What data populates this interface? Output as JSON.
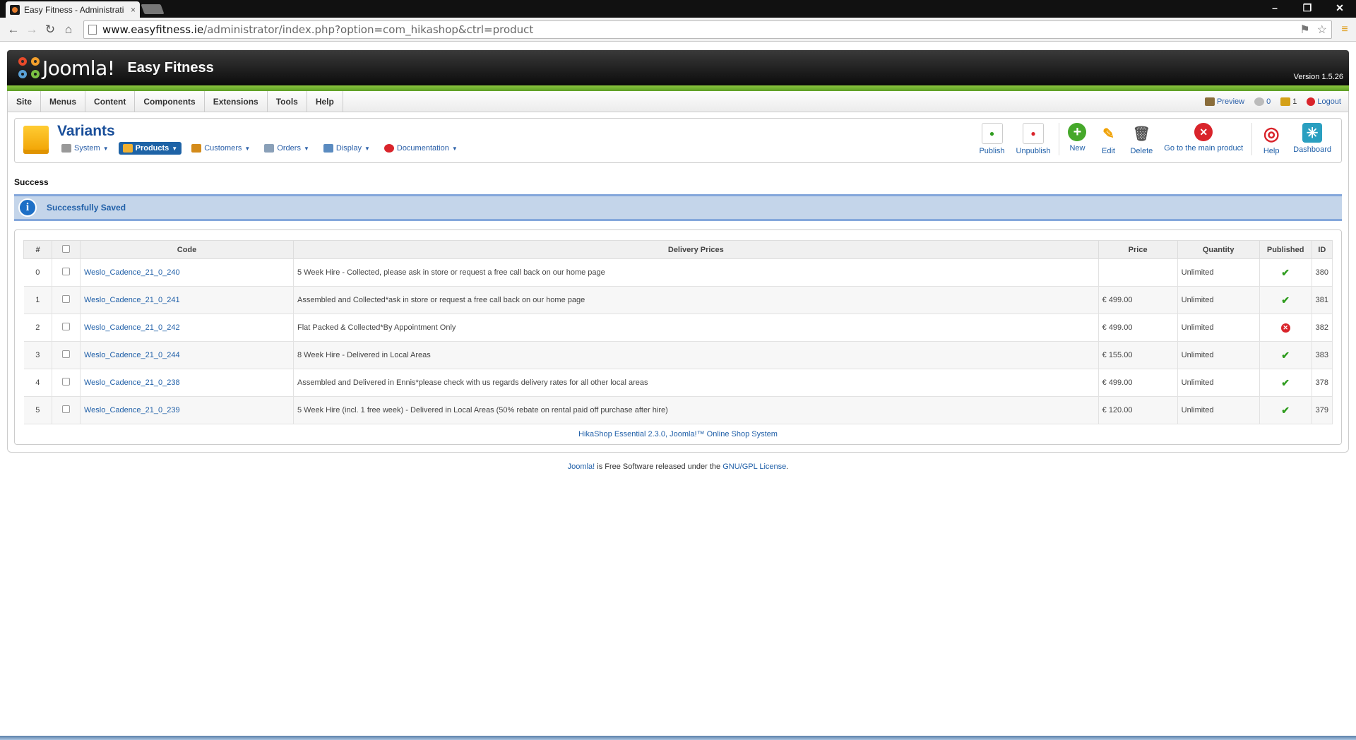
{
  "browser": {
    "tab_title": "Easy Fitness - Administrati",
    "tab_close": "×",
    "url_domain": "www.easyfitness.ie",
    "url_path": "/administrator/index.php?option=com_hikashop&ctrl=product"
  },
  "header": {
    "logo_text": "Joomla!",
    "site_title": "Easy Fitness",
    "version": "Version 1.5.26"
  },
  "menubar": {
    "items": [
      "Site",
      "Menus",
      "Content",
      "Components",
      "Extensions",
      "Tools",
      "Help"
    ],
    "preview": "Preview",
    "messages_count": "0",
    "users_count": "1",
    "logout": "Logout"
  },
  "toolbar": {
    "title": "Variants",
    "submenu": [
      "System",
      "Products",
      "Customers",
      "Orders",
      "Display",
      "Documentation"
    ],
    "buttons": [
      "Publish",
      "Unpublish",
      "New",
      "Edit",
      "Delete",
      "Go to the main product",
      "Help",
      "Dashboard"
    ]
  },
  "message": {
    "heading": "Success",
    "text": "Successfully Saved"
  },
  "table": {
    "headers": [
      "#",
      "Code",
      "Delivery Prices",
      "Price",
      "Quantity",
      "Published",
      "ID"
    ],
    "rows": [
      {
        "num": "0",
        "code": "Weslo_Cadence_21_0_240",
        "delivery": "5 Week Hire - Collected, please ask in store or request a free call back on our home page",
        "price": "",
        "quantity": "Unlimited",
        "published": true,
        "id": "380"
      },
      {
        "num": "1",
        "code": "Weslo_Cadence_21_0_241",
        "delivery": "Assembled and Collected*ask in store or request a free call back on our home page",
        "price": "€ 499.00",
        "quantity": "Unlimited",
        "published": true,
        "id": "381"
      },
      {
        "num": "2",
        "code": "Weslo_Cadence_21_0_242",
        "delivery": "Flat Packed & Collected*By Appointment Only",
        "price": "€ 499.00",
        "quantity": "Unlimited",
        "published": false,
        "id": "382"
      },
      {
        "num": "3",
        "code": "Weslo_Cadence_21_0_244",
        "delivery": "8 Week Hire - Delivered in Local Areas",
        "price": "€ 155.00",
        "quantity": "Unlimited",
        "published": true,
        "id": "383"
      },
      {
        "num": "4",
        "code": "Weslo_Cadence_21_0_238",
        "delivery": "Assembled and Delivered in Ennis*please check with us regards delivery rates for all other local areas",
        "price": "€ 499.00",
        "quantity": "Unlimited",
        "published": true,
        "id": "378"
      },
      {
        "num": "5",
        "code": "Weslo_Cadence_21_0_239",
        "delivery": "5 Week Hire (incl. 1 free week) - Delivered in Local Areas (50% rebate on rental paid off purchase after hire)",
        "price": "€ 120.00",
        "quantity": "Unlimited",
        "published": true,
        "id": "379"
      }
    ],
    "footer": "HikaShop Essential 2.3.0, Joomla!™ Online Shop System"
  },
  "footer": {
    "joomla_link": "Joomla!",
    "middle": " is Free Software released under the ",
    "license_link": "GNU/GPL License",
    "end": "."
  },
  "colors": {
    "accent_blue": "#1f5fa8",
    "green_bar": "#7ac143",
    "info_bg": "#c4d5ea"
  }
}
